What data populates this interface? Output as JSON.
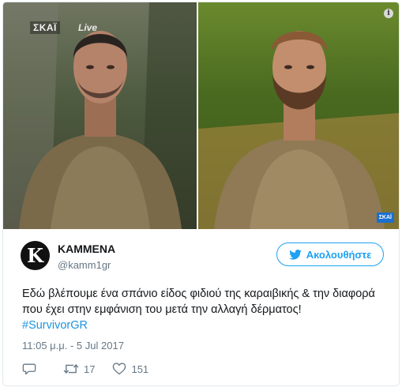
{
  "media": {
    "channel_logo": "ΣΚΑΪ",
    "live_label": "Live",
    "channel_logo_small": "ΣΚΑΪ",
    "info_icon": "info-icon"
  },
  "author": {
    "avatar_letter": "K",
    "display_name": "KAMMENA",
    "handle": "@kamm1gr"
  },
  "follow_button": {
    "label": "Ακολουθήστε",
    "icon": "twitter-bird-icon"
  },
  "tweet": {
    "text": "Εδώ βλέπουμε ένα σπάνιο είδος φιδιού της καραιβικής & την διαφορά που έχει στην εμφάνιση του μετά την αλλαγή δέρματος!",
    "hashtag": "#SurvivorGR",
    "timestamp": "11:05 μ.μ. - 5 Jul 2017"
  },
  "actions": {
    "reply_icon": "reply-icon",
    "retweet_icon": "retweet-icon",
    "retweet_count": "17",
    "like_icon": "heart-icon",
    "like_count": "151"
  },
  "colors": {
    "accent": "#1da1f2",
    "hashtag": "#1b95e0",
    "secondary_text": "#657786",
    "border": "#e1e8ed"
  }
}
